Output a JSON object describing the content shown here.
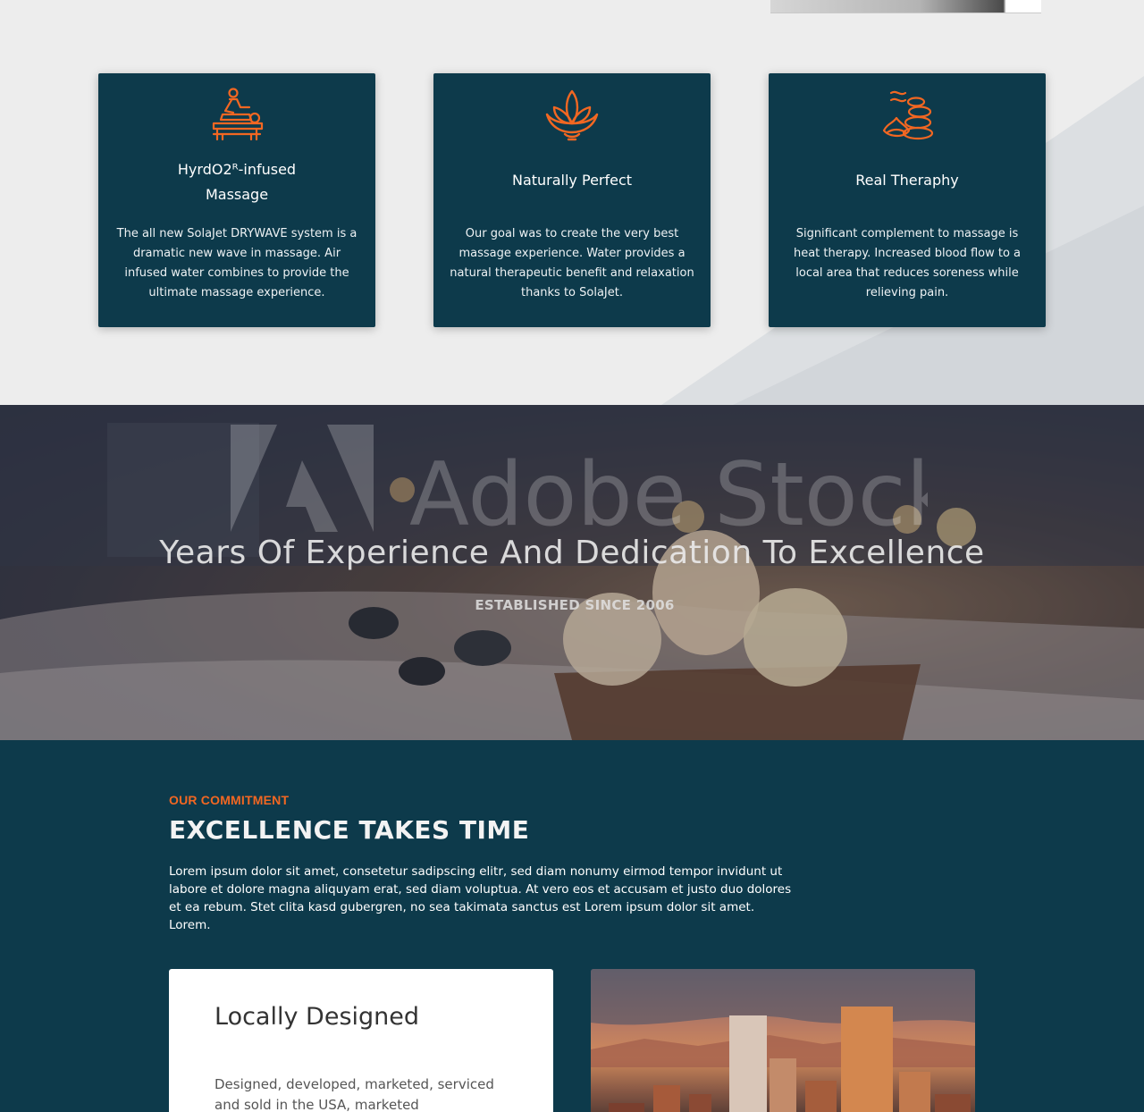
{
  "features": {
    "cards": [
      {
        "icon": "massage-table-icon",
        "title_line1": "HyrdO2ᴿ-infused",
        "title_line2": "Massage",
        "body": "The all new SolaJet DRYWAVE system is a dramatic new wave in massage. Air infused water combines to provide the ultimate massage experience."
      },
      {
        "icon": "lotus-icon",
        "title": "Naturally Perfect",
        "body": "Our goal was to create the very best massage experience. Water provides a natural therapeutic benefit and relaxation thanks to SolaJet."
      },
      {
        "icon": "hot-stones-icon",
        "title": "Real Theraphy",
        "body": "Significant complement to massage is heat therapy. Increased blood flow to a local area that reduces soreness while relieving pain."
      }
    ]
  },
  "hero": {
    "watermark": "Adobe Stock",
    "title": "Years Of Experience And Dedication To Excellence",
    "subtitle": "ESTABLISHED SINCE 2006"
  },
  "commitment": {
    "eyebrow": "OUR COMMITMENT",
    "headline": "EXCELLENCE TAKES TIME",
    "paragraph": "Lorem ipsum dolor sit amet, consetetur sadipscing elitr, sed diam nonumy eirmod tempor invidunt ut labore et dolore magna aliquyam erat, sed diam voluptua. At vero eos et accusam et justo duo dolores et ea rebum. Stet clita kasd gubergren, no sea takimata sanctus est Lorem ipsum dolor sit amet. Lorem.",
    "card": {
      "title": "Locally Designed",
      "body": "Designed, developed, marketed, serviced and sold in the USA, marketed"
    },
    "image": "city-skyline-image"
  },
  "colors": {
    "navy": "#0d3a4b",
    "accent": "#f26722",
    "background": "#ededed"
  }
}
